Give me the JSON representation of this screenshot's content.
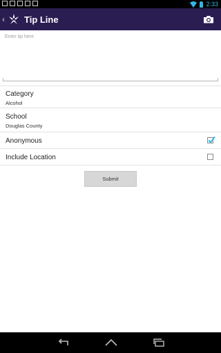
{
  "status_bar": {
    "time": "2:33",
    "notification_icons": [
      "image-icon",
      "photo-icon",
      "download-icon",
      "lock-icon",
      "lock-icon"
    ],
    "accent": "#33b5e5"
  },
  "action_bar": {
    "title": "Tip Line",
    "icons": [
      "chevron-left-icon",
      "app-logo-icon",
      "camera-icon"
    ],
    "background": "#2a1d52"
  },
  "tip": {
    "placeholder": "Enter tip here",
    "value": ""
  },
  "category": {
    "label": "Category",
    "value": "Alcohol"
  },
  "school": {
    "label": "School",
    "value": "Douglas County"
  },
  "anonymous": {
    "label": "Anonymous",
    "checked": true
  },
  "include_location": {
    "label": "Include Location",
    "checked": false
  },
  "submit": {
    "label": "Submit"
  },
  "nav_bar": {
    "icons": [
      "back-icon",
      "home-icon",
      "recents-icon"
    ]
  }
}
